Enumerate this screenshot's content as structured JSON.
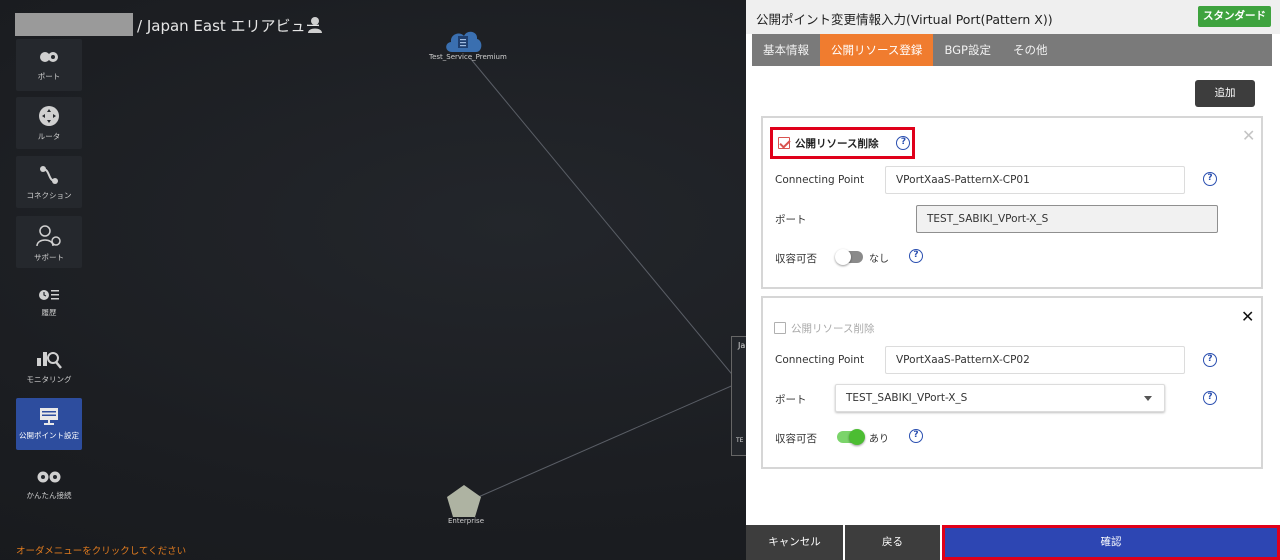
{
  "header": {
    "area_title": "/ Japan East エリアビュー"
  },
  "menu": [
    {
      "id": "port",
      "label": "ポート",
      "icon": "port-icon"
    },
    {
      "id": "router",
      "label": "ルータ",
      "icon": "router-icon"
    },
    {
      "id": "connection",
      "label": "コネクション",
      "icon": "connection-icon"
    },
    {
      "id": "support",
      "label": "サポート",
      "icon": "support-icon"
    },
    {
      "id": "history",
      "label": "履歴",
      "icon": "history-icon"
    },
    {
      "id": "monitoring",
      "label": "モニタリング",
      "icon": "monitoring-icon"
    },
    {
      "id": "public-point",
      "label": "公開ポイント設定",
      "icon": "monitor-icon",
      "active": true
    },
    {
      "id": "easy-connect",
      "label": "かんたん接続",
      "icon": "easy-connect-icon"
    }
  ],
  "hint": "オーダメニューをクリックしてください",
  "nodes": {
    "service": "Test_Service_Premium",
    "enterprise": "Enterprise",
    "partial_top": "Ja",
    "partial_bottom": "TE"
  },
  "panel": {
    "title": "公開ポイント変更情報入力(Virtual Port(Pattern X))",
    "badge": "スタンダード",
    "tabs": [
      {
        "label": "基本情報",
        "active": false
      },
      {
        "label": "公開リソース登録",
        "active": true
      },
      {
        "label": "BGP設定",
        "active": false
      },
      {
        "label": "その他",
        "active": false
      }
    ],
    "add_label": "追加",
    "fields": {
      "delete_label": "公開リソース削除",
      "cp_label": "Connecting Point",
      "port_label": "ポート",
      "accept_label": "収容可否"
    },
    "cards": [
      {
        "delete_checked": true,
        "connecting_point": "VPortXaaS-PatternX-CP01",
        "port": "TEST_SABIKI_VPort-X_S",
        "accept": false,
        "accept_text": "なし"
      },
      {
        "delete_checked": false,
        "connecting_point": "VPortXaaS-PatternX-CP02",
        "port": "TEST_SABIKI_VPort-X_S",
        "accept": true,
        "accept_text": "あり"
      }
    ],
    "footer": {
      "cancel": "キャンセル",
      "back": "戻る",
      "confirm": "確認"
    }
  },
  "colors": {
    "accent_orange": "#f07c2f",
    "badge_green": "#3ea33e",
    "confirm_blue": "#2d46b3",
    "highlight_red": "#e0001a",
    "active_menu": "#2d4d9e"
  }
}
